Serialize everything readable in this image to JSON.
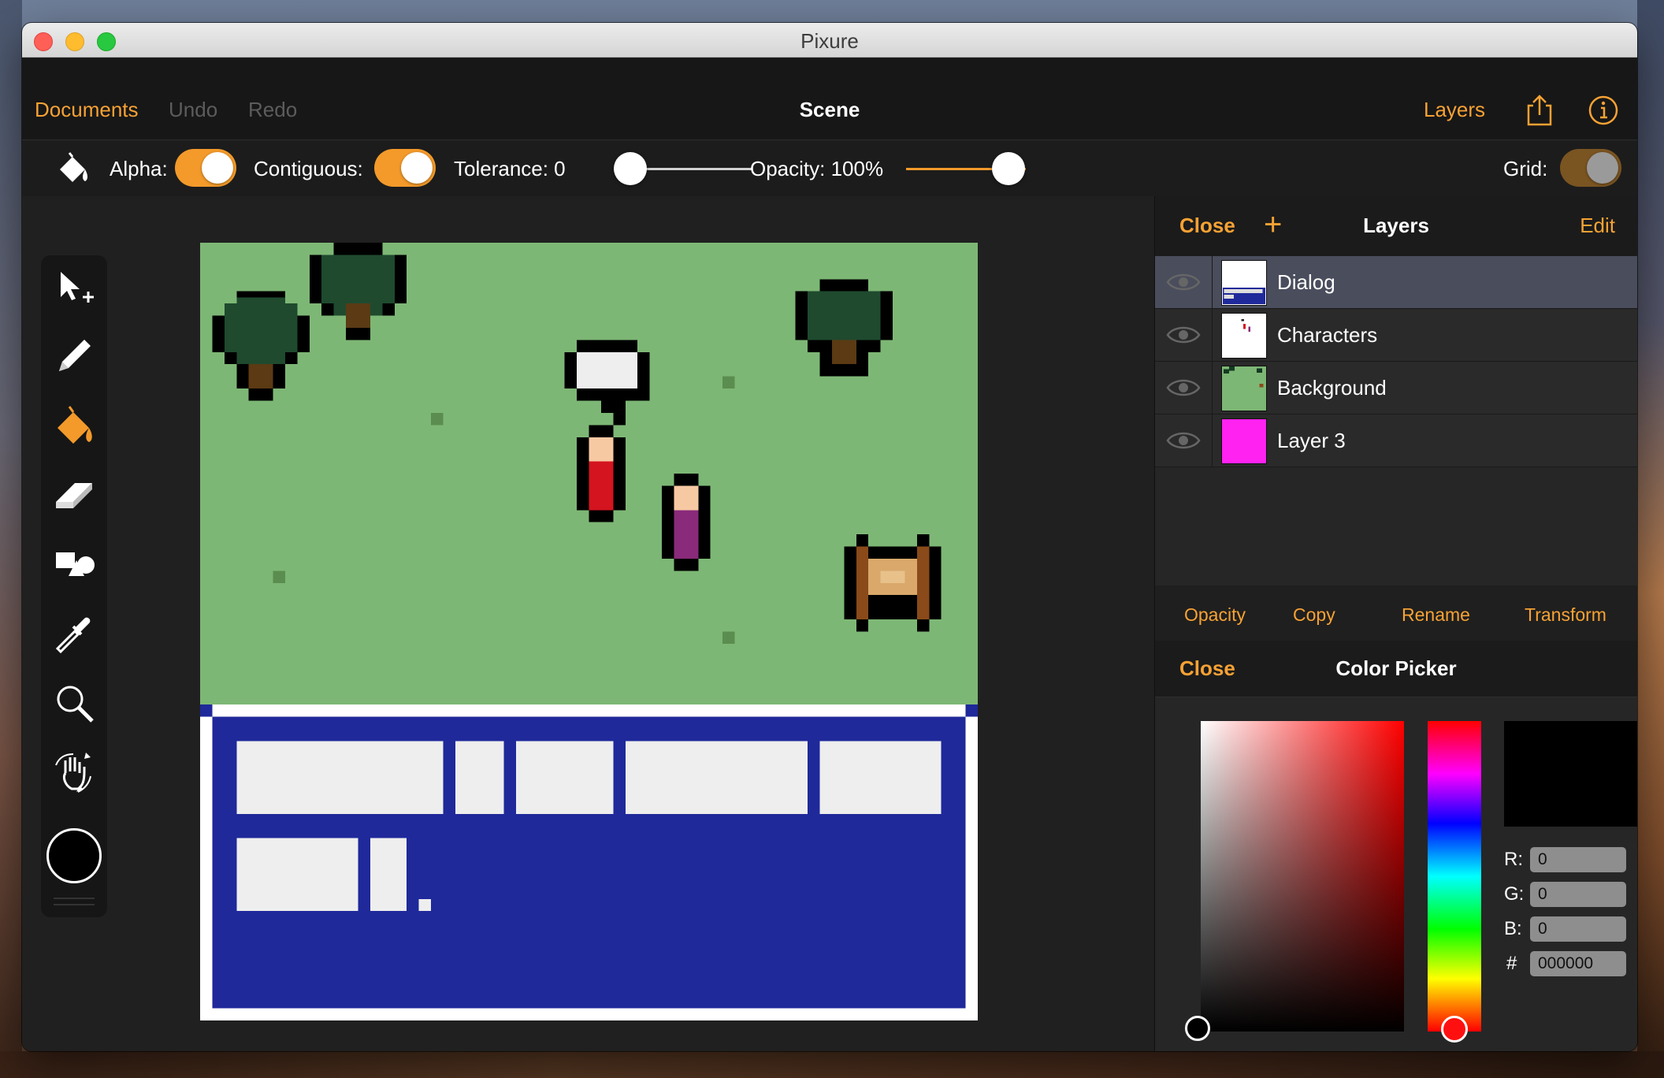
{
  "window": {
    "title": "Pixure"
  },
  "navbar": {
    "documents": "Documents",
    "undo": "Undo",
    "redo": "Redo",
    "title": "Scene",
    "layers": "Layers"
  },
  "toolbar": {
    "alpha_label": "Alpha:",
    "contiguous_label": "Contiguous:",
    "tolerance_label": "Tolerance: 0",
    "opacity_label": "Opacity: 100%",
    "grid_label": "Grid:",
    "tolerance_value": 0,
    "opacity_value": 100,
    "alpha_on": true,
    "contiguous_on": true,
    "grid_on": false
  },
  "tools": [
    "move-icon",
    "pencil-icon",
    "paint-bucket-icon",
    "eraser-icon",
    "shapes-icon",
    "eyedropper-icon",
    "zoom-icon",
    "pan-icon"
  ],
  "active_tool": "paint-bucket-icon",
  "layers_panel": {
    "close": "Close",
    "title": "Layers",
    "edit": "Edit",
    "layers": [
      {
        "name": "Dialog",
        "selected": true
      },
      {
        "name": "Characters",
        "selected": false
      },
      {
        "name": "Background",
        "selected": false
      },
      {
        "name": "Layer 3",
        "selected": false
      }
    ],
    "actions": [
      "Opacity",
      "Copy",
      "Rename",
      "Transform"
    ]
  },
  "color_picker": {
    "close": "Close",
    "title": "Color Picker",
    "r_label": "R:",
    "g_label": "G:",
    "b_label": "B:",
    "hex_label": "#",
    "r": "0",
    "g": "0",
    "b": "0",
    "hex": "000000"
  },
  "colors": {
    "accent": "#f7a234",
    "grass": "#7db775",
    "dialog_blue": "#1f299a",
    "layer3": "#ff22f0"
  }
}
